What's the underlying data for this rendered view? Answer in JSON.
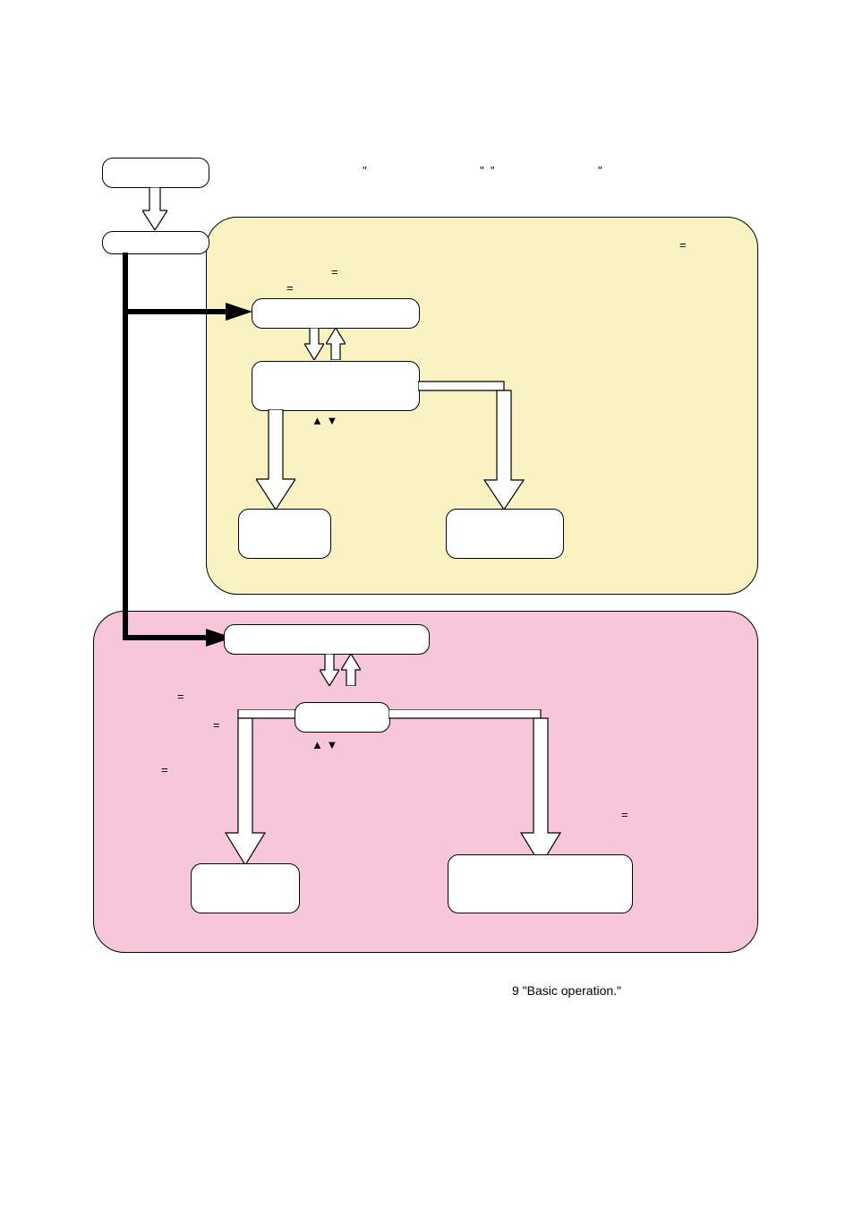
{
  "yellow_zone": {
    "fill": "#f8f3c0"
  },
  "pink_zone": {
    "fill": "#f7c6db"
  },
  "footer": {
    "text": "9 \"Basic operation.\""
  },
  "nodes": {
    "start": {
      "label": ""
    },
    "branch": {
      "label": ""
    },
    "y1": {
      "label": ""
    },
    "y2": {
      "label": ""
    },
    "y_out_left": {
      "label": ""
    },
    "y_out_right": {
      "label": ""
    },
    "p1": {
      "label": ""
    },
    "p2": {
      "label": ""
    },
    "p_out_left": {
      "label": ""
    },
    "p_out_right": {
      "label": ""
    }
  },
  "annotations": {
    "top_a": "\"",
    "top_b": "\"  \"",
    "top_c": "\"",
    "eq1": "=",
    "eq2": "=",
    "eq3": "=",
    "eq4": "=",
    "eq5": "=",
    "eq6": "=",
    "eq7": "=",
    "tri1": "▲ ▼",
    "tri2": "▲ ▼"
  }
}
